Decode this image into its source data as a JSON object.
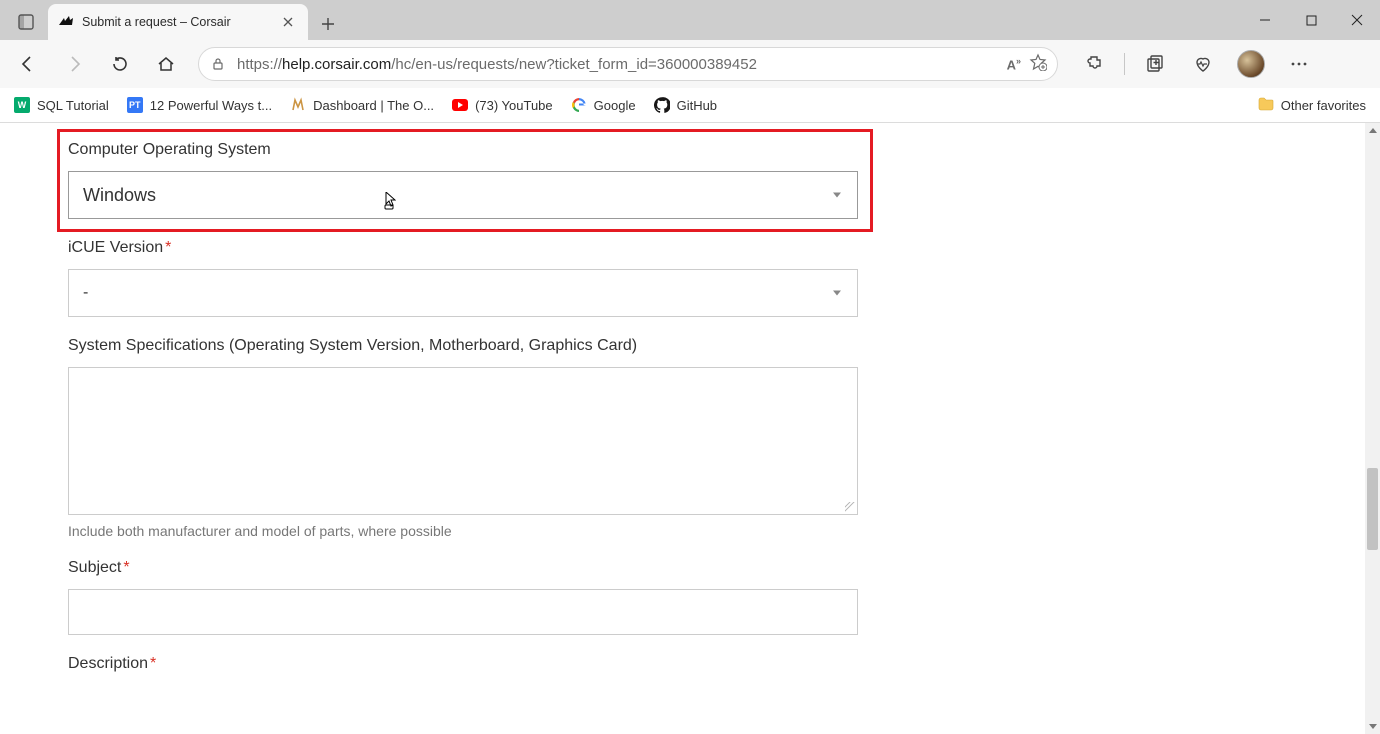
{
  "browser": {
    "tab_title": "Submit a request – Corsair",
    "url_scheme": "https://",
    "url_host": "help.corsair.com",
    "url_path": "/hc/en-us/requests/new?ticket_form_id=360000389452"
  },
  "bookmarks": [
    {
      "label": "SQL Tutorial",
      "icon": "w3"
    },
    {
      "label": "12 Powerful Ways t...",
      "icon": "pt"
    },
    {
      "label": "Dashboard | The O...",
      "icon": "odin"
    },
    {
      "label": "(73) YouTube",
      "icon": "yt"
    },
    {
      "label": "Google",
      "icon": "g"
    },
    {
      "label": "GitHub",
      "icon": "gh"
    }
  ],
  "other_favorites_label": "Other favorites",
  "form": {
    "os": {
      "label": "Computer Operating System",
      "value": "Windows"
    },
    "icue": {
      "label": "iCUE Version",
      "required": true,
      "value": "-"
    },
    "specs": {
      "label": "System Specifications (Operating System Version, Motherboard, Graphics Card)",
      "helper": "Include both manufacturer and model of parts, where possible"
    },
    "subject": {
      "label": "Subject",
      "required": true
    },
    "description": {
      "label": "Description",
      "required": true
    }
  }
}
